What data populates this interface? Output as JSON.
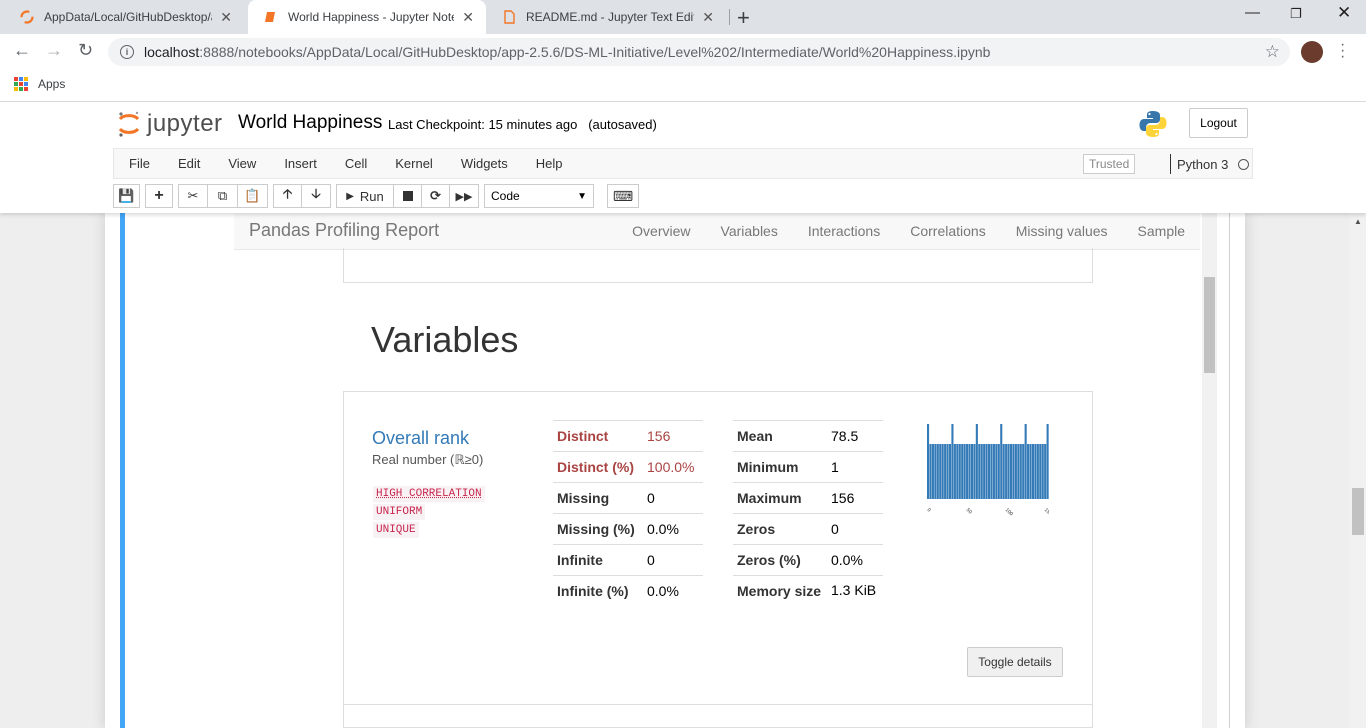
{
  "browser": {
    "tabs": [
      {
        "title": "AppData/Local/GitHubDesktop/a",
        "close": "✕"
      },
      {
        "title": "World Happiness - Jupyter Noteb",
        "close": "✕"
      },
      {
        "title": "README.md - Jupyter Text Editor",
        "close": "✕"
      }
    ],
    "new_tab": "+",
    "url_host": "localhost",
    "url_path": ":8888/notebooks/AppData/Local/GitHubDesktop/app-2.5.6/DS-ML-Initiative/Level%202/Intermediate/World%20Happiness.ipynb",
    "bookmarks": {
      "apps_label": "Apps"
    }
  },
  "jupyter": {
    "logo_text": "jupyter",
    "notebook_name": "World Happiness",
    "checkpoint": "Last Checkpoint: 15 minutes ago",
    "autosave": "(autosaved)",
    "logout": "Logout",
    "menu": [
      "File",
      "Edit",
      "View",
      "Insert",
      "Cell",
      "Kernel",
      "Widgets",
      "Help"
    ],
    "trusted": "Trusted",
    "kernel_name": "Python 3",
    "toolbar": {
      "run_label": "Run",
      "cell_type": "Code"
    }
  },
  "report": {
    "nav_title": "Pandas Profiling Report",
    "nav_links": [
      "Overview",
      "Variables",
      "Interactions",
      "Correlations",
      "Missing values",
      "Sample"
    ],
    "section_title": "Variables",
    "variable": {
      "name": "Overall rank",
      "type": "Real number (ℝ≥0)",
      "alerts": [
        "HIGH CORRELATION",
        "UNIFORM",
        "UNIQUE"
      ],
      "stats_left": [
        {
          "label": "Distinct",
          "value": "156"
        },
        {
          "label": "Distinct (%)",
          "value": "100.0%"
        },
        {
          "label": "Missing",
          "value": "0"
        },
        {
          "label": "Missing (%)",
          "value": "0.0%"
        },
        {
          "label": "Infinite",
          "value": "0"
        },
        {
          "label": "Infinite (%)",
          "value": "0.0%"
        }
      ],
      "stats_right": [
        {
          "label": "Mean",
          "value": "78.5"
        },
        {
          "label": "Minimum",
          "value": "1"
        },
        {
          "label": "Maximum",
          "value": "156"
        },
        {
          "label": "Zeros",
          "value": "0"
        },
        {
          "label": "Zeros (%)",
          "value": "0.0%"
        },
        {
          "label": "Memory size",
          "value": "1.3 KiB"
        }
      ],
      "toggle": "Toggle details"
    },
    "histogram": {
      "tick_labels": [
        "0",
        "50",
        "100",
        "150"
      ],
      "color": "#337ab7"
    }
  },
  "colors": {
    "accent": "#42a5f5",
    "warn": "#a94442",
    "link": "#337ab7"
  }
}
